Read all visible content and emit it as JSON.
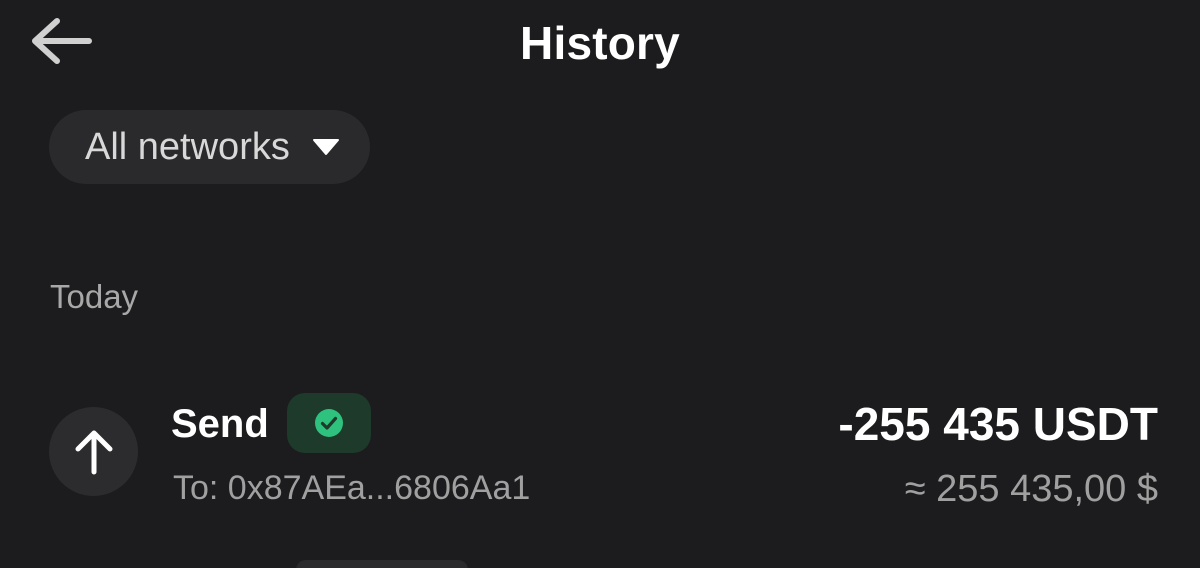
{
  "header": {
    "title": "History",
    "back_icon": "arrow-left-icon"
  },
  "filter": {
    "network_label": "All networks",
    "dropdown_icon": "caret-down-icon"
  },
  "section": {
    "label": "Today"
  },
  "transactions": [
    {
      "type": "Send",
      "direction_icon": "arrow-up-icon",
      "status_icon": "check-circle-icon",
      "recipient": "To: 0x87AEa...6806Aa1",
      "amount": "-255 435 USDT",
      "fiat_value": "≈ 255 435,00 $"
    }
  ],
  "colors": {
    "background": "#1c1c1e",
    "surface": "#2a2a2c",
    "success": "#2ec27e",
    "success_bg": "#1d3a2a",
    "text_primary": "#ffffff",
    "text_secondary": "#a0a0a0"
  }
}
